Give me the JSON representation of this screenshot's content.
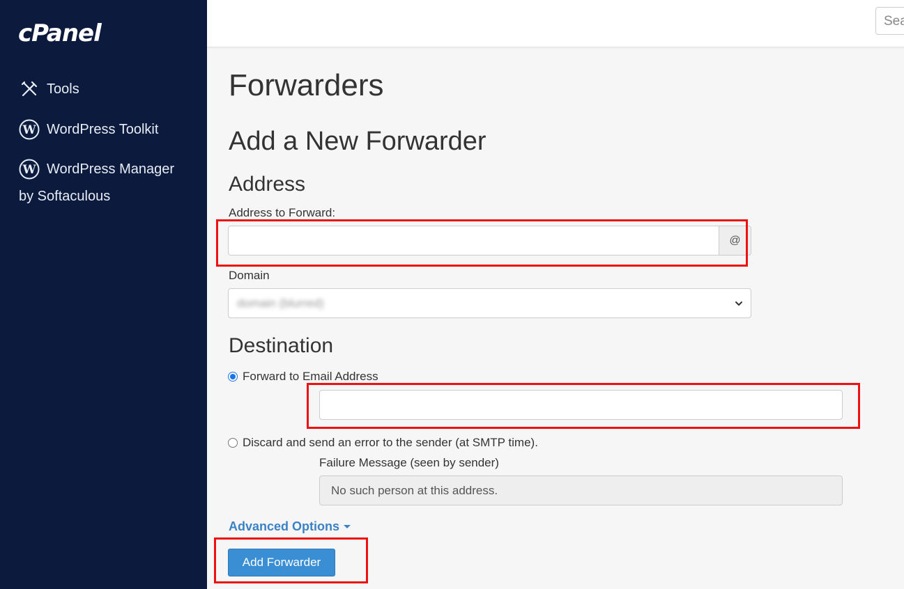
{
  "app": {
    "logo_text": "cPanel"
  },
  "sidebar": {
    "items": [
      {
        "label": "Tools",
        "icon": "tools-icon"
      },
      {
        "label": "WordPress Toolkit",
        "icon": "wordpress-icon"
      },
      {
        "label": "WordPress Manager",
        "label_line2": "by Softaculous",
        "icon": "wordpress-icon"
      }
    ]
  },
  "topbar": {
    "search_placeholder": "Search"
  },
  "page": {
    "title": "Forwarders",
    "section_title": "Add a New Forwarder",
    "address": {
      "heading": "Address",
      "address_label": "Address to Forward:",
      "address_value": "",
      "at_symbol": "@",
      "domain_label": "Domain",
      "domain_value": "domain (blurred)"
    },
    "destination": {
      "heading": "Destination",
      "forward_option_label": "Forward to Email Address",
      "forward_option_checked": true,
      "forward_email_value": "",
      "discard_option_label": "Discard and send an error to the sender (at SMTP time).",
      "discard_option_checked": false,
      "failure_label": "Failure Message (seen by sender)",
      "failure_message": "No such person at this address."
    },
    "advanced_options_label": "Advanced Options",
    "submit_label": "Add Forwarder"
  },
  "colors": {
    "sidebar_bg": "#0b1a3d",
    "primary": "#3a8ed4",
    "link": "#3b82c4",
    "highlight": "#ee1111"
  }
}
